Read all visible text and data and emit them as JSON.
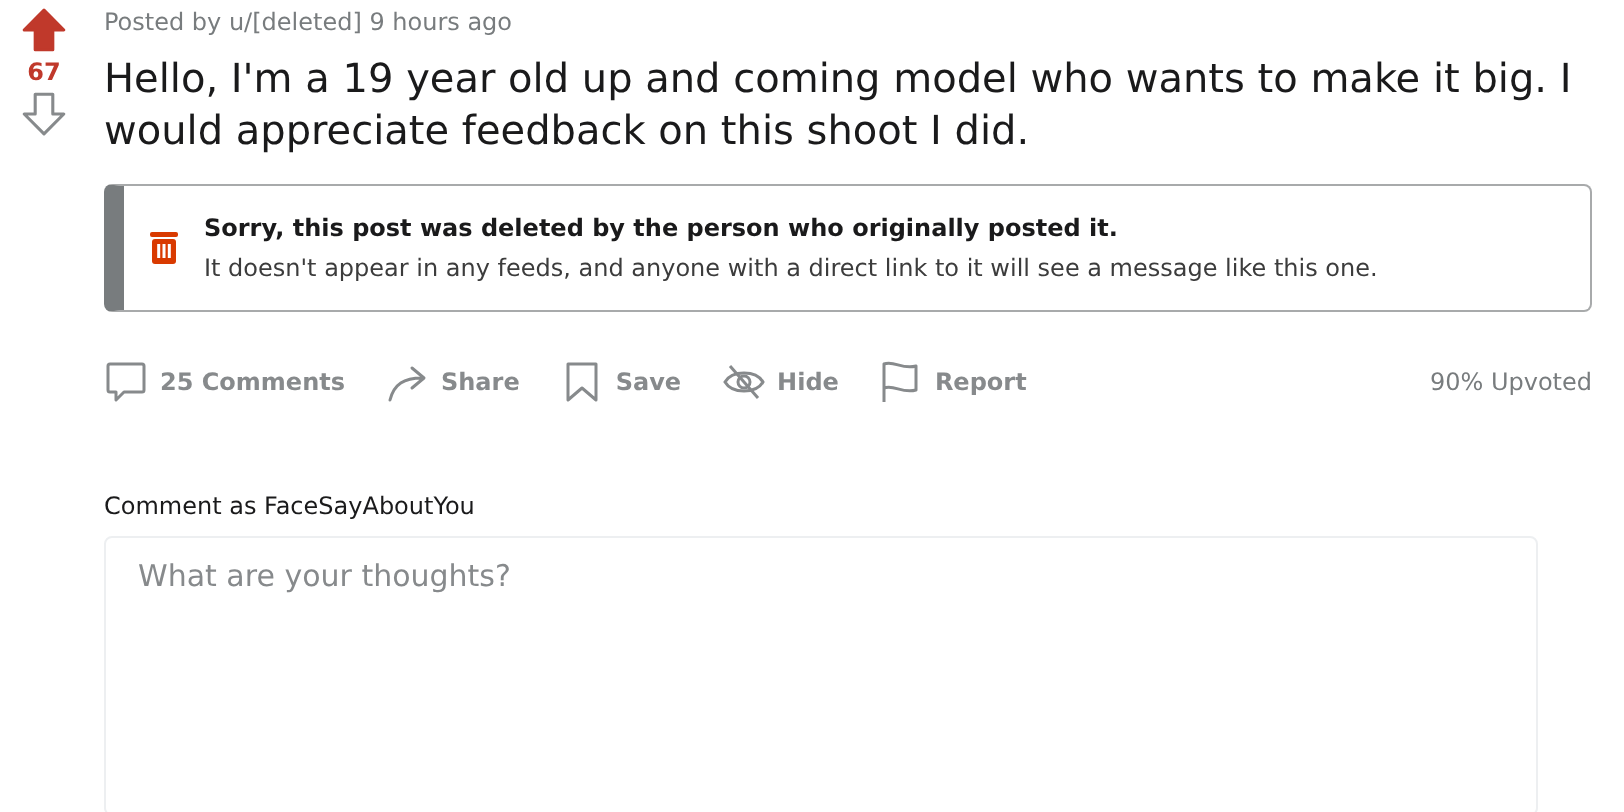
{
  "vote": {
    "upvoted": true,
    "downvoted": false,
    "score": "67"
  },
  "post": {
    "meta": "Posted by u/[deleted] 9 hours ago",
    "title": "Hello, I'm a 19 year old up and coming model who wants to make it big. I would appreciate feedback on this shoot I did."
  },
  "notice": {
    "heading": "Sorry, this post was deleted by the person who originally posted it.",
    "body": "It doesn't appear in any feeds, and anyone with a direct link to it will see a message like this one."
  },
  "actions": [
    {
      "kind": "comments",
      "label": "25 Comments"
    },
    {
      "kind": "share",
      "label": "Share"
    },
    {
      "kind": "save",
      "label": "Save"
    },
    {
      "kind": "hide",
      "label": "Hide"
    },
    {
      "kind": "report",
      "label": "Report"
    }
  ],
  "upvote_ratio": "90% Upvoted",
  "comment": {
    "label": "Comment as FaceSayAboutYou",
    "placeholder": "What are your thoughts?"
  }
}
